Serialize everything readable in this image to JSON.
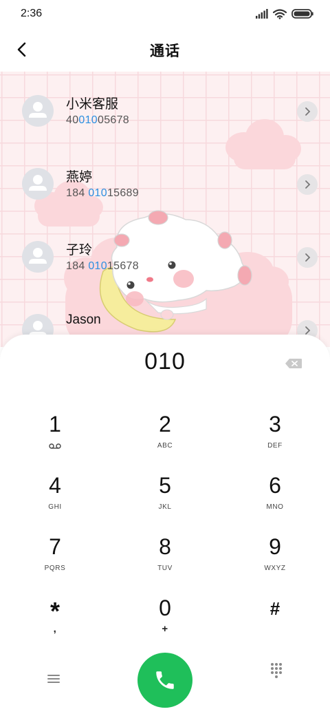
{
  "status_bar": {
    "time": "2:36"
  },
  "header": {
    "title": "通话"
  },
  "contacts": [
    {
      "name": "小米客服",
      "number_parts": [
        "40",
        "010",
        "05678"
      ]
    },
    {
      "name": "燕婷",
      "number_parts": [
        "184 ",
        "010",
        "15689"
      ]
    },
    {
      "name": "子玲",
      "number_parts": [
        "184 ",
        "010",
        "15678"
      ]
    },
    {
      "name": "Jason",
      "number_parts": [
        "",
        "",
        ""
      ]
    }
  ],
  "dialpad": {
    "input": "010",
    "keys": [
      {
        "digit": "1",
        "letters": ""
      },
      {
        "digit": "2",
        "letters": "ABC"
      },
      {
        "digit": "3",
        "letters": "DEF"
      },
      {
        "digit": "4",
        "letters": "GHI"
      },
      {
        "digit": "5",
        "letters": "JKL"
      },
      {
        "digit": "6",
        "letters": "MNO"
      },
      {
        "digit": "7",
        "letters": "PQRS"
      },
      {
        "digit": "8",
        "letters": "TUV"
      },
      {
        "digit": "9",
        "letters": "WXYZ"
      },
      {
        "digit": "*",
        "letters": ","
      },
      {
        "digit": "0",
        "letters": "+"
      },
      {
        "digit": "#",
        "letters": ""
      }
    ]
  },
  "icons": {
    "back": "back-arrow-icon",
    "detail": "chevron-right-icon",
    "backspace": "backspace-icon",
    "menu": "menu-icon",
    "call": "phone-icon",
    "keypad": "keypad-icon",
    "voicemail": "voicemail-icon"
  },
  "colors": {
    "match_highlight": "#2d8fe0",
    "call_button": "#1fbf5a",
    "contacts_background": "#fdf0f1"
  }
}
